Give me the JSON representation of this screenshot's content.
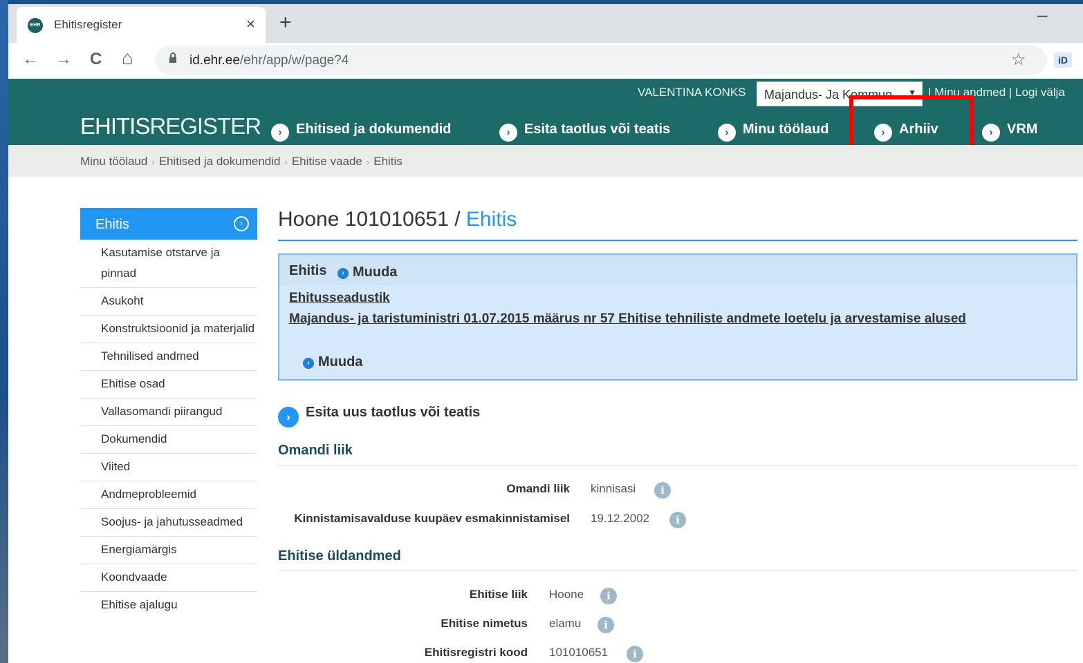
{
  "browser": {
    "tab_title": "Ehitisregister",
    "tab_favicon": "EHR",
    "tab_close": "×",
    "new_tab": "+",
    "minimize": "–",
    "nav": {
      "back": "←",
      "forward": "→",
      "reload": "C",
      "home": "⌂"
    },
    "url_host": "id.ehr.ee",
    "url_path": "/ehr/app/w/page?4",
    "star": "☆",
    "ext_label": "iD"
  },
  "header": {
    "logo_bold": "EHITIS",
    "logo_thin": "REGISTER",
    "user_name": "VALENTINA KONKS",
    "org_select_value": "Majandus- Ja Kommun...",
    "org_select_arrow": "▼",
    "user_links": "| Minu andmed | Logi välja",
    "nav_items": [
      {
        "label": "Ehitised ja dokumendid"
      },
      {
        "label": "Esita taotlus või teatis"
      },
      {
        "label": "Minu töölaud"
      },
      {
        "label": "Arhiiv"
      },
      {
        "label": "VRM"
      }
    ],
    "nav_icon": "›"
  },
  "breadcrumb": [
    "Minu töölaud",
    "Ehitised ja dokumendid",
    "Ehitise vaade",
    "Ehitis"
  ],
  "breadcrumb_sep": "›",
  "sidebar": {
    "head": "Ehitis",
    "head_icon": "›",
    "items": [
      "Kasutamise otstarve ja pinnad",
      "Asukoht",
      "Konstruktsioonid ja materjalid",
      "Tehnilised andmed",
      "Ehitise osad",
      "Vallasomandi piirangud",
      "Dokumendid",
      "Viited",
      "Andmeprobleemid",
      "Soojus- ja jahutusseadmed",
      "Energiamärgis",
      "Koondvaade",
      "Ehitise ajalugu"
    ]
  },
  "main": {
    "title_prefix": "Hoone 101010651 / ",
    "title_accent": "Ehitis",
    "infobox": {
      "title": "Ehitis",
      "edit_label": "Muuda",
      "link1": "Ehitusseadustik",
      "link2": "Majandus- ja taristuministri 01.07.2015 määrus nr 57 Ehitise tehniliste andmete loetelu ja arvestamise alused",
      "edit_label2": "Muuda"
    },
    "cta": "Esita uus taotlus või teatis",
    "section1": "Omandi liik",
    "omandi_liik_label": "Omandi liik",
    "omandi_liik_value": "kinnisasi",
    "kinnistamine_label": "Kinnistamisavalduse kuupäev esmakinnistamisel",
    "kinnistamine_value": "19.12.2002",
    "section2": "Ehitise üldandmed",
    "ehitise_liik_label": "Ehitise liik",
    "ehitise_liik_value": "Hoone",
    "ehitise_nimetus_label": "Ehitise nimetus",
    "ehitise_nimetus_value": "elamu",
    "kood_label": "Ehitisregistri kood",
    "kood_value": "101010651",
    "info_icon": "i"
  }
}
